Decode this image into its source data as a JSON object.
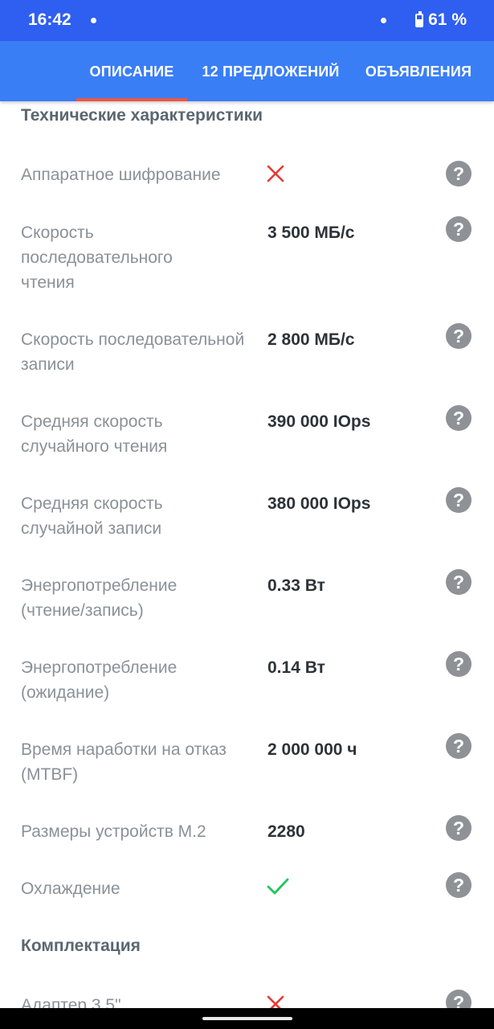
{
  "status_bar": {
    "time": "16:42",
    "battery": "61 %",
    "battery_level": 0.61
  },
  "tabs": [
    {
      "label": "ОПИСАНИЕ",
      "active": true
    },
    {
      "label": "12 ПРЕДЛОЖЕНИЙ",
      "active": false
    },
    {
      "label": "ОБЪЯВЛЕНИЯ",
      "active": false
    }
  ],
  "sections": {
    "specs_title": "Технические характеристики",
    "kit_title": "Комплектация"
  },
  "specs": [
    {
      "label": "Аппаратное шифрование",
      "value": "",
      "icon": "cross-icon"
    },
    {
      "label": "Скорость последовательного чтения",
      "value": "3 500 МБ/с"
    },
    {
      "label": "Скорость последовательной записи",
      "value": "2 800 МБ/с"
    },
    {
      "label": "Средняя скорость случайного чтения",
      "value": "390 000 IOps"
    },
    {
      "label": "Средняя скорость случайной записи",
      "value": "380 000 IOps"
    },
    {
      "label": "Энергопотребление (чтение/запись)",
      "value": "0.33 Вт"
    },
    {
      "label": "Энергопотребление (ожидание)",
      "value": "0.14 Вт"
    },
    {
      "label": "Время наработки на отказ (MTBF)",
      "value": "2 000 000 ч"
    },
    {
      "label": "Размеры устройств M.2",
      "value": "2280"
    },
    {
      "label": "Охлаждение",
      "value": "",
      "icon": "check-icon"
    }
  ],
  "kit": [
    {
      "label": "Адаптер 3.5\"",
      "value": "",
      "icon": "cross-icon"
    }
  ],
  "help_glyph": "?",
  "colors": {
    "status_bar": "#2f5ff0",
    "tab_bar": "#3a7ef6",
    "indicator": "#e8574b",
    "cross": "#e53935",
    "check": "#22c55e"
  }
}
